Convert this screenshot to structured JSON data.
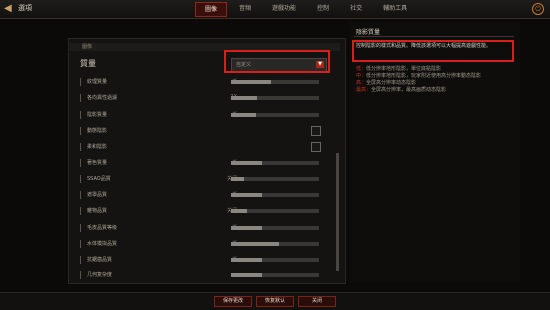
{
  "header": {
    "title": "選項",
    "back_icon": "arrow-back-icon",
    "exit_icon": "exit-icon"
  },
  "tabs": [
    "圖像",
    "音頻",
    "遊戲功能",
    "控制",
    "社交",
    "輔助工具"
  ],
  "section": {
    "label": "圖像"
  },
  "quality": {
    "label": "質量",
    "dropdown_value": "自定义"
  },
  "settings": [
    {
      "label": "紋理質量",
      "value": "低",
      "fill": 0.45,
      "kind": "slider"
    },
    {
      "label": "各向異性過濾",
      "value": "2X",
      "fill": 0.3,
      "kind": "slider"
    },
    {
      "label": "陰影質量",
      "value": "低",
      "fill": 0.28,
      "kind": "slider"
    },
    {
      "label": "動態陰影",
      "kind": "check"
    },
    {
      "label": "柔和陰影",
      "kind": "check"
    },
    {
      "label": "著色質量",
      "value": "低",
      "fill": 0.35,
      "kind": "slider"
    },
    {
      "label": "SSAO品質",
      "value": "关闭",
      "fill": 0.15,
      "kind": "slider"
    },
    {
      "label": "遮罩品質",
      "value": "低",
      "fill": 0.35,
      "kind": "slider"
    },
    {
      "label": "雜物品質",
      "value": "关闭",
      "fill": 0.18,
      "kind": "slider"
    },
    {
      "label": "毛皮品質等级",
      "value": "低",
      "fill": 0.35,
      "kind": "slider"
    },
    {
      "label": "水体模拟品質",
      "value": "低",
      "fill": 0.55,
      "kind": "slider"
    },
    {
      "label": "抗鋸齒品質",
      "value": "低",
      "fill": 0.35,
      "kind": "slider"
    },
    {
      "label": "几何复杂度",
      "value": "",
      "fill": 0.35,
      "kind": "slider"
    }
  ],
  "right_panel": {
    "title": "陰影質量",
    "description": "控制陰影的樣式和品質。降低該選項可以大幅提高遊戲性能。",
    "levels": [
      {
        "level": "低：",
        "text": "低分辨率地形陰影，單位底點陰影"
      },
      {
        "level": "中：",
        "text": "低分辨率地形陰影，玩家附近使用高分辨率動态陰影"
      },
      {
        "level": "高：",
        "text": "全屏高分辨率动态陰影"
      },
      {
        "level": "最高：",
        "text": "全屏高分辨率，最高画质动态陰影"
      }
    ]
  },
  "buttons": [
    "保存更改",
    "恢复默认",
    "关闭"
  ]
}
